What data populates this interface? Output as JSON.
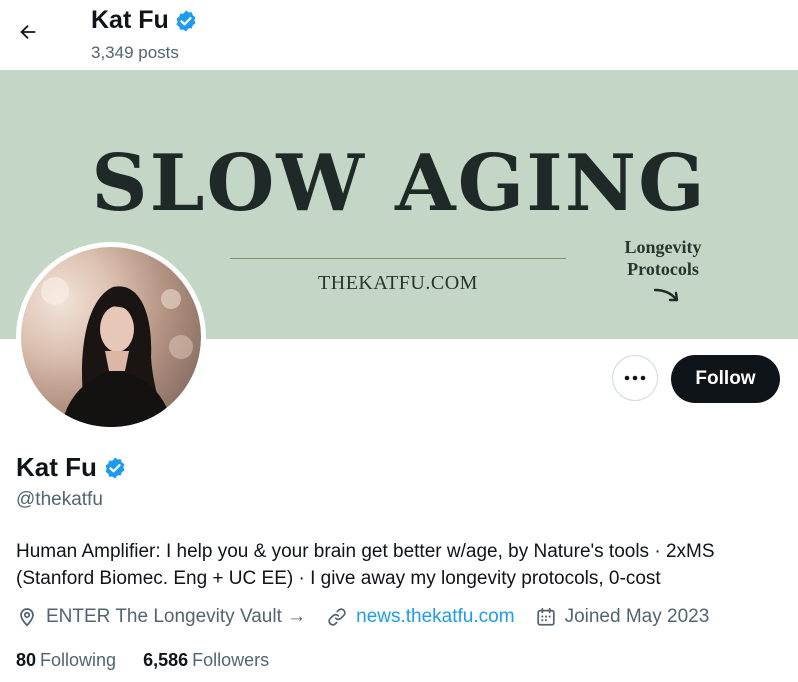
{
  "header": {
    "name": "Kat Fu",
    "posts": "3,349 posts"
  },
  "banner": {
    "title": "SLOW AGING",
    "url": "THEKATFU.COM",
    "side_line1": "Longevity",
    "side_line2": "Protocols",
    "background": "#c4d6c6"
  },
  "actions": {
    "more_label": "•••",
    "follow_label": "Follow"
  },
  "profile": {
    "name": "Kat Fu",
    "handle": "@thekatfu",
    "verified_color": "#1d9bf0",
    "bio_line1": "Human Amplifier: I help you & your brain get better w/age, by Nature's tools · 2xMS",
    "bio_line2": "(Stanford Biomec. Eng + UC EE) · I give away my longevity protocols, 0-cost",
    "location": "ENTER The Longevity Vault →",
    "website": "news.thekatfu.com",
    "joined": "Joined May 2023",
    "following_count": "80",
    "following_label": "Following",
    "followers_count": "6,586",
    "followers_label": "Followers"
  },
  "icons": [
    "back-arrow-icon",
    "verified-badge-icon",
    "location-pin-icon",
    "link-icon",
    "calendar-icon",
    "more-dots-icon"
  ]
}
